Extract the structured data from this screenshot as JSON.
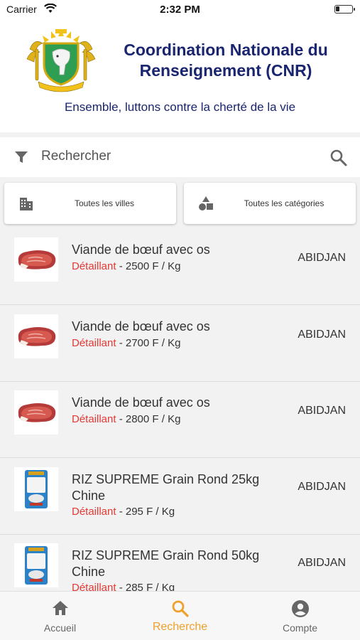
{
  "status_bar": {
    "carrier": "Carrier",
    "time": "2:32 PM",
    "battery_level": 0.25
  },
  "header": {
    "title": "Coordination Nationale du Renseignement (CNR)",
    "tagline": "Ensemble, luttons contre la cherté de la vie"
  },
  "search": {
    "placeholder": "Rechercher",
    "value": ""
  },
  "filters": {
    "city_label": "Toutes les villes",
    "category_label": "Toutes les catégories"
  },
  "items": [
    {
      "name": "Viande de bœuf avec os",
      "type": "Détaillant",
      "price": " - 2500 F / Kg",
      "city": "ABIDJAN",
      "image": "beef-steak"
    },
    {
      "name": "Viande de bœuf avec os",
      "type": "Détaillant",
      "price": " - 2700 F / Kg",
      "city": "ABIDJAN",
      "image": "beef-steak"
    },
    {
      "name": "Viande de bœuf avec os",
      "type": "Détaillant",
      "price": " - 2800 F / Kg",
      "city": "ABIDJAN",
      "image": "beef-steak"
    },
    {
      "name": "RIZ SUPREME Grain Rond 25kg Chine",
      "type": "Détaillant",
      "price": " - 295 F / Kg",
      "city": "ABIDJAN",
      "image": "rice-bag"
    },
    {
      "name": "RIZ SUPREME Grain Rond 50kg Chine",
      "type": "Détaillant",
      "price": " - 285 F / Kg",
      "city": "ABIDJAN",
      "image": "rice-bag"
    }
  ],
  "tabs": [
    {
      "label": "Accueil",
      "icon": "home-icon",
      "active": false
    },
    {
      "label": "Recherche",
      "icon": "search-icon",
      "active": true
    },
    {
      "label": "Compte",
      "icon": "account-icon",
      "active": false
    }
  ],
  "colors": {
    "accent": "#f0a02a",
    "brand": "#1a2570",
    "seller_type": "#e53935"
  }
}
